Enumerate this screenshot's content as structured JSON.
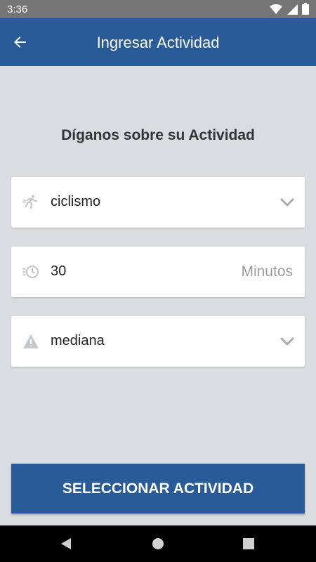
{
  "status_bar": {
    "time": "3:36"
  },
  "app_bar": {
    "title": "Ingresar Actividad"
  },
  "heading": "Díganos sobre su Actividad",
  "fields": {
    "activity": {
      "value": "ciclismo",
      "icon": "running-person-icon"
    },
    "duration": {
      "value": "30",
      "unit": "Minutos",
      "icon": "fast-clock-icon"
    },
    "intensity": {
      "value": "mediana",
      "icon": "warning-icon"
    }
  },
  "button": {
    "label": "SELECCIONAR ACTIVIDAD"
  },
  "colors": {
    "primary": "#285b98",
    "background": "#dadde0",
    "icon": "#c4c8cc",
    "status_bar": "#757575"
  }
}
